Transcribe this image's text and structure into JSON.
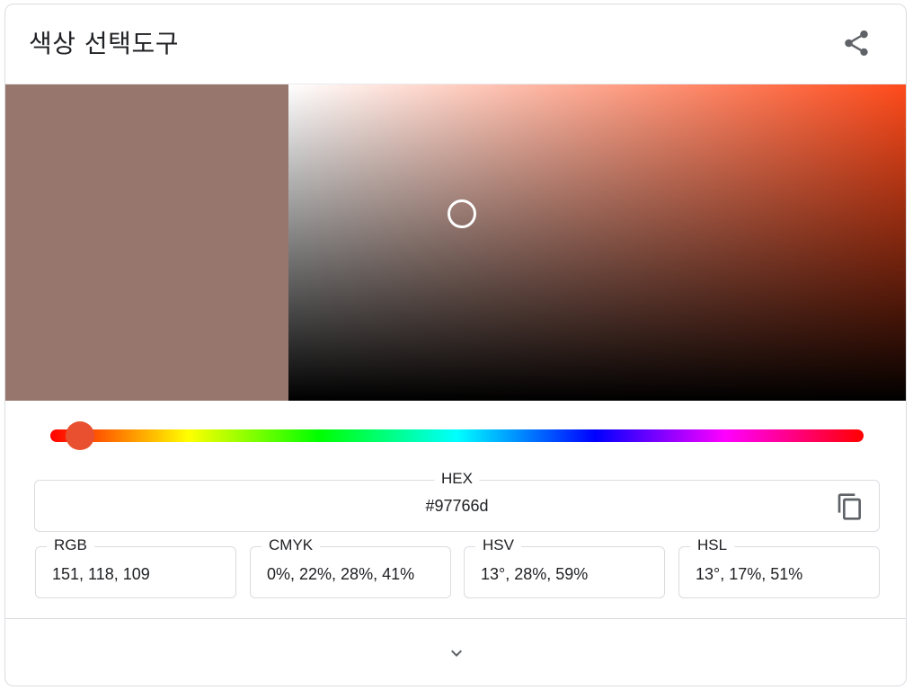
{
  "header": {
    "title": "색상 선택도구",
    "share_icon": "share-icon"
  },
  "colors": {
    "selected": "#97766d",
    "hue_color": "#e8502f",
    "sv_background": "#ff4a1a"
  },
  "picker": {
    "saturation": 0.28,
    "value": 0.59,
    "hue_deg": 13
  },
  "fields": {
    "hex": {
      "label": "HEX",
      "value": "#97766d"
    },
    "rgb": {
      "label": "RGB",
      "value": "151, 118, 109"
    },
    "cmyk": {
      "label": "CMYK",
      "value": "0%, 22%, 28%, 41%"
    },
    "hsv": {
      "label": "HSV",
      "value": "13°, 28%, 59%"
    },
    "hsl": {
      "label": "HSL",
      "value": "13°, 17%, 51%"
    }
  },
  "icons": {
    "copy": "copy-icon",
    "expand": "chevron-down-icon"
  }
}
